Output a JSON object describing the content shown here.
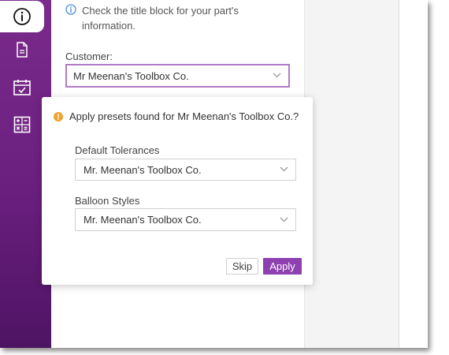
{
  "colors": {
    "sidebar_top": "#7a2b8b",
    "sidebar_bottom": "#4e1463",
    "accent": "#8e3fb0",
    "info_blue": "#4a90d9",
    "warning_orange": "#f0a22a"
  },
  "sidebar": {
    "items": [
      {
        "icon": "info-circle-icon",
        "active": true
      },
      {
        "icon": "document-icon",
        "active": false
      },
      {
        "icon": "calendar-check-icon",
        "active": false
      },
      {
        "icon": "calculator-icon",
        "active": false
      }
    ]
  },
  "panel": {
    "info_text": "Check the title block for your part's information.",
    "customer_label": "Customer:",
    "customer_value": "Mr Meenan's Toolbox Co."
  },
  "popup": {
    "message": "Apply presets found for Mr Meenan's Toolbox Co.?",
    "tolerances_label": "Default Tolerances",
    "tolerances_value": "Mr. Meenan's Toolbox Co.",
    "balloon_label": "Balloon Styles",
    "balloon_value": "Mr. Meenan's Toolbox Co.",
    "skip_label": "Skip",
    "apply_label": "Apply"
  }
}
